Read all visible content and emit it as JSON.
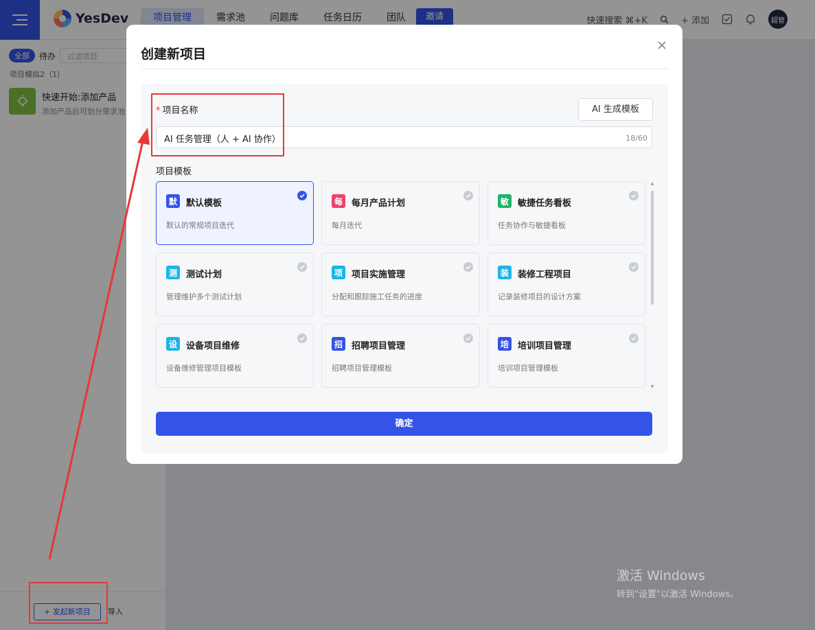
{
  "app": {
    "brand": "YesDev",
    "nav": [
      {
        "label": "项目管理",
        "active": true
      },
      {
        "label": "需求池",
        "active": false
      },
      {
        "label": "问题库",
        "active": false
      },
      {
        "label": "任务日历",
        "active": false
      },
      {
        "label": "团队",
        "active": false
      }
    ],
    "invite_label": "邀请",
    "quick_search": "快速搜索 ⌘+K",
    "add_label": "+ 添加",
    "avatar_text": "超管",
    "accent_color": "#3553e6"
  },
  "sidebar": {
    "filter_all": "全部",
    "filter_todo": "待办",
    "filter_placeholder": "过滤项目",
    "group_label": "项目模拟2（1）",
    "project": {
      "title": "快速开始:添加产品",
      "subtitle": "添加产品后可划分需求池"
    },
    "new_project_label": "+ 发起新项目",
    "import_label": "导入"
  },
  "modal": {
    "title": "创建新项目",
    "name_label": "项目名称",
    "required_mark": "*",
    "ai_template_label": "AI 生成模板",
    "name_value": "AI 任务管理（人 + AI 协作）",
    "name_count": "18/60",
    "template_label": "项目模板",
    "templates": [
      {
        "badge": "默",
        "name": "默认模板",
        "desc": "默认的常规项目迭代",
        "color": "#3553e6",
        "selected": true
      },
      {
        "badge": "每",
        "name": "每月产品计划",
        "desc": "每月迭代",
        "color": "#f0426a",
        "selected": false
      },
      {
        "badge": "敏",
        "name": "敏捷任务看板",
        "desc": "任务协作与敏捷看板",
        "color": "#1fb36b",
        "selected": false
      },
      {
        "badge": "测",
        "name": "测试计划",
        "desc": "管理维护多个测试计划",
        "color": "#1cb5e8",
        "selected": false
      },
      {
        "badge": "项",
        "name": "项目实施管理",
        "desc": "分配和跟踪施工任务的进度",
        "color": "#1cb5e8",
        "selected": false
      },
      {
        "badge": "装",
        "name": "装修工程项目",
        "desc": "记录装修项目的设计方案",
        "color": "#1cb5e8",
        "selected": false
      },
      {
        "badge": "设",
        "name": "设备项目维修",
        "desc": "设备维修管理项目模板",
        "color": "#1cb5e8",
        "selected": false
      },
      {
        "badge": "招",
        "name": "招聘项目管理",
        "desc": "招聘项目管理模板",
        "color": "#3553e6",
        "selected": false
      },
      {
        "badge": "培",
        "name": "培训项目管理",
        "desc": "培训项目管理模板",
        "color": "#3553e6",
        "selected": false
      }
    ],
    "confirm_label": "确定"
  },
  "watermark": {
    "win_title": "激活 Windows",
    "win_sub": "转到\"设置\"以激活 Windows。"
  },
  "annotation_color": "#e5383b"
}
